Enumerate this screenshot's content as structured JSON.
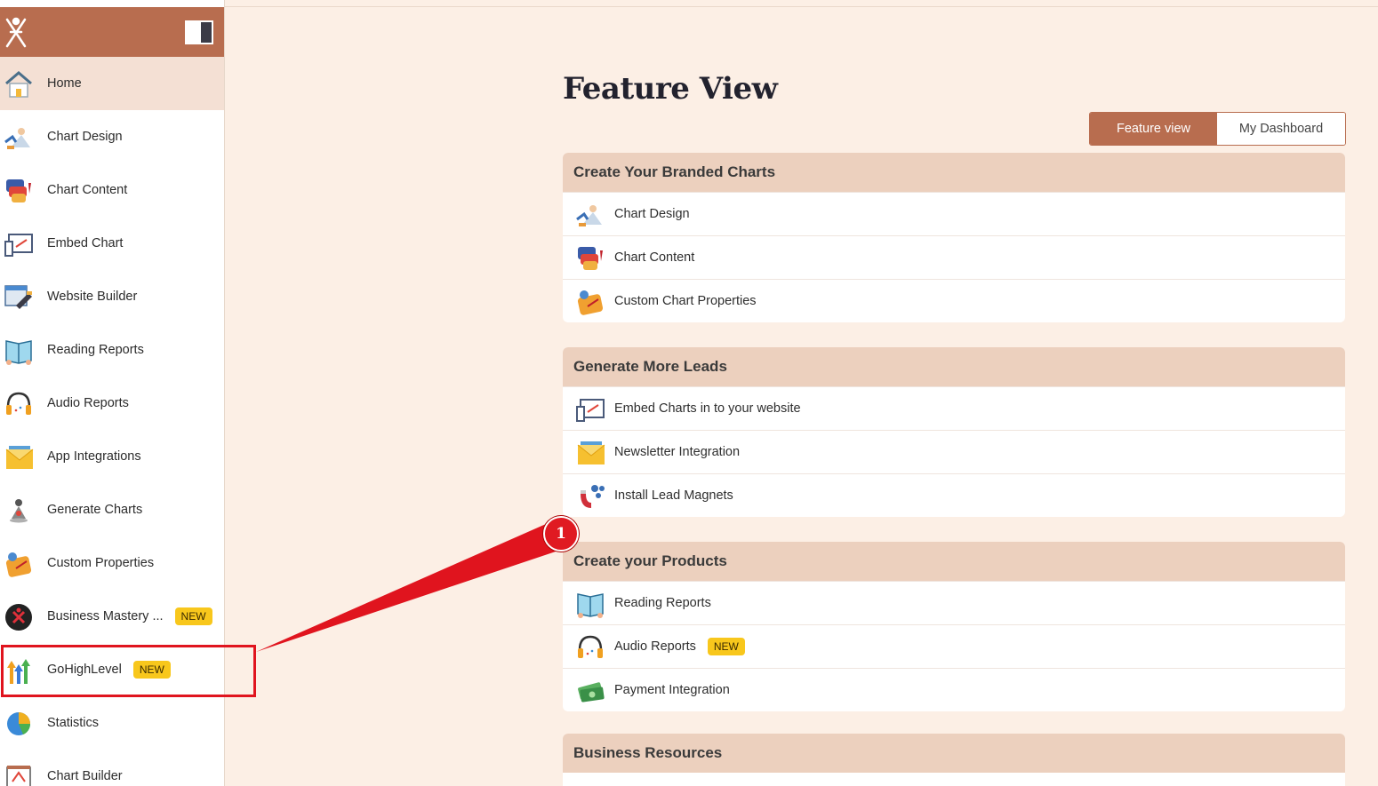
{
  "sidebar": {
    "items": [
      {
        "label": "Home",
        "icon": "home-icon",
        "badge": ""
      },
      {
        "label": "Chart Design",
        "icon": "chart-design-icon",
        "badge": ""
      },
      {
        "label": "Chart Content",
        "icon": "chart-content-icon",
        "badge": ""
      },
      {
        "label": "Embed Chart",
        "icon": "embed-chart-icon",
        "badge": ""
      },
      {
        "label": "Website Builder",
        "icon": "website-builder-icon",
        "badge": ""
      },
      {
        "label": "Reading Reports",
        "icon": "reading-reports-icon",
        "badge": ""
      },
      {
        "label": "Audio Reports",
        "icon": "headphones-icon",
        "badge": ""
      },
      {
        "label": "App Integrations",
        "icon": "envelope-icon",
        "badge": ""
      },
      {
        "label": "Generate Charts",
        "icon": "generate-charts-icon",
        "badge": ""
      },
      {
        "label": "Custom Properties",
        "icon": "custom-properties-icon",
        "badge": ""
      },
      {
        "label": "Business Mastery ...",
        "icon": "business-mastery-icon",
        "badge": "NEW"
      },
      {
        "label": "GoHighLevel",
        "icon": "gohighlevel-icon",
        "badge": "NEW"
      },
      {
        "label": "Statistics",
        "icon": "pie-chart-icon",
        "badge": ""
      },
      {
        "label": "Chart Builder",
        "icon": "chart-builder-icon",
        "badge": ""
      }
    ]
  },
  "main": {
    "title": "Feature View",
    "toggle": {
      "feature_view": "Feature view",
      "my_dashboard": "My Dashboard"
    },
    "sections": [
      {
        "title": "Create Your Branded Charts",
        "rows": [
          {
            "label": "Chart Design",
            "icon": "chart-design-icon",
            "badge": ""
          },
          {
            "label": "Chart Content",
            "icon": "chart-content-icon",
            "badge": ""
          },
          {
            "label": "Custom Chart Properties",
            "icon": "custom-properties-icon",
            "badge": ""
          }
        ]
      },
      {
        "title": "Generate More Leads",
        "rows": [
          {
            "label": "Embed Charts in to your website",
            "icon": "embed-chart-icon",
            "badge": ""
          },
          {
            "label": "Newsletter Integration",
            "icon": "envelope-icon",
            "badge": ""
          },
          {
            "label": "Install Lead Magnets",
            "icon": "magnet-icon",
            "badge": ""
          }
        ]
      },
      {
        "title": "Create your Products",
        "rows": [
          {
            "label": "Reading Reports",
            "icon": "reading-reports-icon",
            "badge": ""
          },
          {
            "label": "Audio Reports",
            "icon": "headphones-icon",
            "badge": "NEW"
          },
          {
            "label": "Payment Integration",
            "icon": "money-icon",
            "badge": ""
          }
        ]
      },
      {
        "title": "Business Resources",
        "rows": []
      }
    ]
  },
  "annotation": {
    "marker_number": "1"
  },
  "colors": {
    "brand": "#b86d4f",
    "background": "#fcefe5",
    "card_header": "#ecd0be",
    "badge": "#f8c71c",
    "highlight": "#e0141e"
  }
}
